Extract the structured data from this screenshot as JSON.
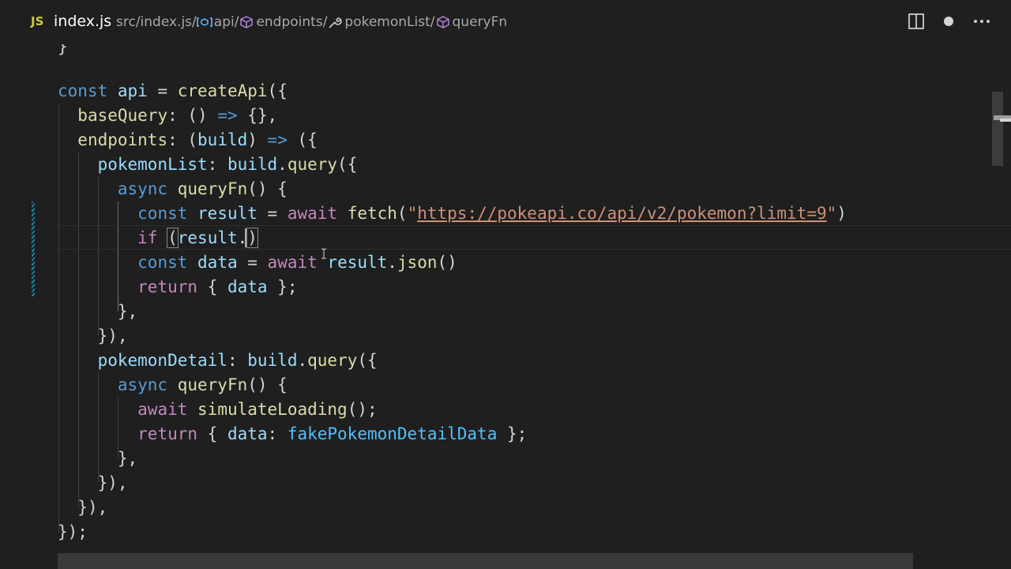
{
  "tab": {
    "language_badge": "JS",
    "filename": "index.js"
  },
  "breadcrumb": {
    "path": "src/index.js/",
    "items": [
      "api/",
      "endpoints/",
      "pokemonList/",
      "queryFn"
    ],
    "icons": [
      "variable-icon",
      "module-cube-icon",
      "wrench-property-icon",
      "method-cube-icon"
    ]
  },
  "actions": {
    "icons": [
      "split-editor-icon",
      "unsaved-dot-icon",
      "more-actions-icon"
    ]
  },
  "colors": {
    "keyword": "#569cd6",
    "control": "#c586c0",
    "variable": "#9cdcfe",
    "constant": "#4fc1ff",
    "function": "#dcdcaa",
    "string": "#ce9178",
    "js_badge": "#cbcb41"
  },
  "code": {
    "l0": "}",
    "l1": {
      "kw": "const",
      "name": "api",
      "eq": " = ",
      "fn": "createApi",
      "rest": "({"
    },
    "l2": {
      "prop": "baseQuery",
      "rest": ": () ",
      "arrow": "=>",
      "tail": " {},"
    },
    "l3": {
      "prop": "endpoints",
      "rest": ": (",
      "param": "build",
      "rest2": ") ",
      "arrow": "=>",
      "tail": " ({"
    },
    "l4": {
      "prop": "pokemonList",
      "rest": ": ",
      "obj": "build",
      "dot": ".",
      "fn": "query",
      "tail": "({"
    },
    "l5": {
      "kw": "async",
      "fn": "queryFn",
      "tail": "() {"
    },
    "l6": {
      "kw": "const",
      "name": "result",
      "eq": " = ",
      "await": "await",
      "fn": "fetch",
      "open": "(",
      "str_q1": "\"",
      "url": "https://pokeapi.co/api/v2/pokemon?limit=9",
      "str_q2": "\"",
      "close": ")"
    },
    "l7": {
      "ctl": "if",
      "open": "(",
      "obj": "result",
      "dot": ".",
      "close": ")"
    },
    "l8": {
      "kw": "const",
      "name": "data",
      "eq": " = ",
      "await": "await",
      "obj": "result",
      "dot": ".",
      "fn": "json",
      "tail": "()"
    },
    "l9": {
      "ctl": "return",
      "open": " { ",
      "var": "data",
      "close": " };"
    },
    "l10": "},",
    "l11": "}),",
    "l12": {
      "prop": "pokemonDetail",
      "rest": ": ",
      "obj": "build",
      "dot": ".",
      "fn": "query",
      "tail": "({"
    },
    "l13": {
      "kw": "async",
      "fn": "queryFn",
      "tail": "() {"
    },
    "l14": {
      "await": "await",
      "fn": "simulateLoading",
      "tail": "();"
    },
    "l15": {
      "ctl": "return",
      "open": " { ",
      "prop": "data",
      "colon": ": ",
      "cst": "fakePokemonDetailData",
      "close": " };"
    },
    "l16": "},",
    "l17": "}),",
    "l18": "}),",
    "l19": "});"
  }
}
